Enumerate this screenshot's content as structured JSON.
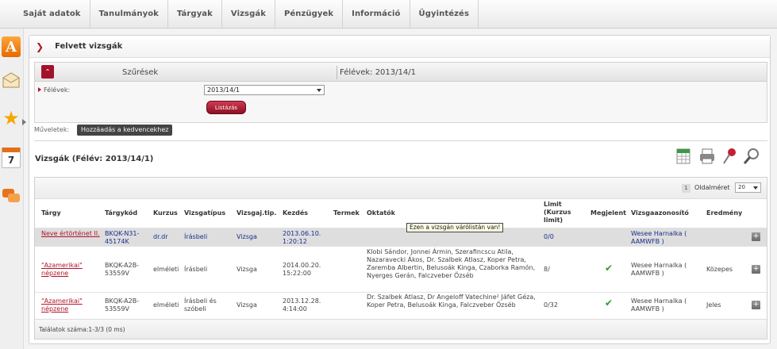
{
  "topnav": {
    "items": [
      "Saját adatok",
      "Tanulmányok",
      "Tárgyak",
      "Vizsgák",
      "Pénzügyek",
      "Információ",
      "Ügyintézés"
    ]
  },
  "panel": {
    "title": "Felvett vizsgák"
  },
  "filter": {
    "header_label": "Szűrések",
    "semester_header": "Félévek: 2013/14/1",
    "semester_label": "Félévek:",
    "semester_value": "2013/14/1",
    "list_button": "Listázás"
  },
  "actions": {
    "label": "Műveletek:",
    "favorite_button": "Hozzáadás a kedvencekhez"
  },
  "exams": {
    "title": "Vizsgák (Félév: 2013/14/1)",
    "page_number": "1",
    "page_size_label": "Oldalméret",
    "page_size_value": "20",
    "columns": {
      "subject": "Tárgy",
      "code": "Tárgykód",
      "course": "Kurzus",
      "type": "Vizsgatípus",
      "exam_type": "Vizsgaj.tip.",
      "start": "Kezdés",
      "rooms": "Termek",
      "examiners": "Oktatók",
      "limit": "Limit (Kurzus limit)",
      "registered": "Megjelent",
      "exam_id": "Vizsgaazonosító",
      "result": "Eredmény"
    },
    "tooltip": "Ezen a vizsgán várólistán van!",
    "rows": [
      {
        "subject": "Neve értörténet II.",
        "code": "BKQK-N31-45174K",
        "course": "dr.dr",
        "type": "Írásbeli",
        "exam_type": "Vizsga",
        "start": "2013.06.10. 1:20:12",
        "examiners": "",
        "limit": "0/0",
        "registered": "",
        "exam_id": "Wesee Harnalka ( AAMWFB )",
        "result": ""
      },
      {
        "subject": "\"Azamerikai\" népzene",
        "code": "BKQK-A2B-53559V",
        "course": "elméleti",
        "type": "Írásbeli",
        "exam_type": "Vizsga",
        "start": "2014.00.20. 15:22:00",
        "examiners": "Klobi Sándor, Jonnei Ármin, Szerafincscu Atila, Nazaravecki Ákos, Dr. Szalbek Atlasz, Koper Petra, Zaremba Albertin, Belusoák Kinga, Czaborka Ramón, Nyerges Gerán, Falczveber Őzséb",
        "limit": "8/",
        "registered": "✔",
        "exam_id": "Wesee Harnalka ( AAMWFB )",
        "result": "Közepes"
      },
      {
        "subject": "\"Azamerikai\" népzene",
        "code": "BKQK-A2B-53559V",
        "course": "elméleti",
        "type": "Írásbeli és szóbeli",
        "exam_type": "Vizsga",
        "start": "2013.12.28. 4:14:00",
        "examiners": "Dr. Szalbek Atlasz, Dr Angeloff Vatechine² Jáfet Géza, Koper Petra, Belusoák Kinga, Falczveber Őzséb",
        "limit": "0/32",
        "registered": "✔",
        "exam_id": "Wesee Harnalka ( AAMWFB )",
        "result": "Jeles"
      }
    ],
    "footer": "Találatok száma:1-3/3 (0 ms)"
  }
}
